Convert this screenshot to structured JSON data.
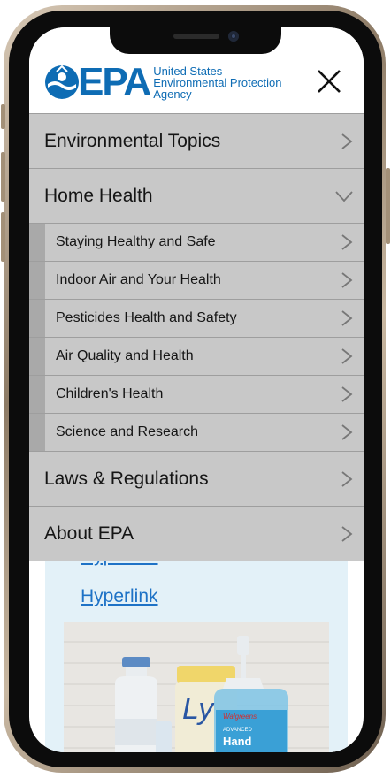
{
  "header": {
    "logo_letters": "EPA",
    "logo_line1": "United States",
    "logo_line2": "Environmental Protection",
    "logo_line3": "Agency",
    "brand_color": "#0e6cb4"
  },
  "menu": {
    "items": [
      {
        "label": "Environmental Topics",
        "icon": "chevron-right-icon"
      },
      {
        "label": "Home Health",
        "icon": "chevron-down-icon",
        "expanded": true
      },
      {
        "label": "Laws & Regulations",
        "icon": "chevron-right-icon"
      },
      {
        "label": "About EPA",
        "icon": "chevron-right-icon"
      }
    ],
    "sub_items": [
      {
        "label": "Staying Healthy and Safe"
      },
      {
        "label": "Indoor Air and Your Health"
      },
      {
        "label": "Pesticides Health and Safety"
      },
      {
        "label": "Air Quality and Health"
      },
      {
        "label": "Children's Health"
      },
      {
        "label": "Science and Research"
      }
    ]
  },
  "content": {
    "links": [
      "Hyperlink",
      "Hyperlink"
    ],
    "photo_label_brand": "Walgreens",
    "photo_label_advanced": "ADVANCED",
    "photo_label_product": "Hand"
  },
  "colors": {
    "menu_bg": "#c8c8c8",
    "sub_bar": "#a9a9a9",
    "content_bg": "#e3f1f8",
    "link": "#1e72c6"
  }
}
